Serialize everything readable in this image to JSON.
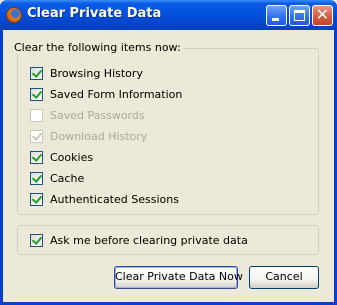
{
  "window": {
    "title": "Clear Private Data"
  },
  "group": {
    "legend": "Clear the following items now:",
    "items": [
      {
        "label": "Browsing History",
        "checked": true,
        "disabled": false
      },
      {
        "label": "Saved Form Information",
        "checked": true,
        "disabled": false
      },
      {
        "label": "Saved Passwords",
        "checked": false,
        "disabled": true
      },
      {
        "label": "Download History",
        "checked": true,
        "disabled": true
      },
      {
        "label": "Cookies",
        "checked": true,
        "disabled": false
      },
      {
        "label": "Cache",
        "checked": true,
        "disabled": false
      },
      {
        "label": "Authenticated Sessions",
        "checked": true,
        "disabled": false
      }
    ]
  },
  "ask": {
    "label": "Ask me before clearing private data",
    "checked": true
  },
  "buttons": {
    "clear": "Clear Private Data Now",
    "cancel": "Cancel"
  },
  "colors": {
    "titlebar": "#0451e0",
    "dialog": "#ece9d8",
    "checkmark": "#21a121",
    "disabled_text": "#aca899"
  }
}
